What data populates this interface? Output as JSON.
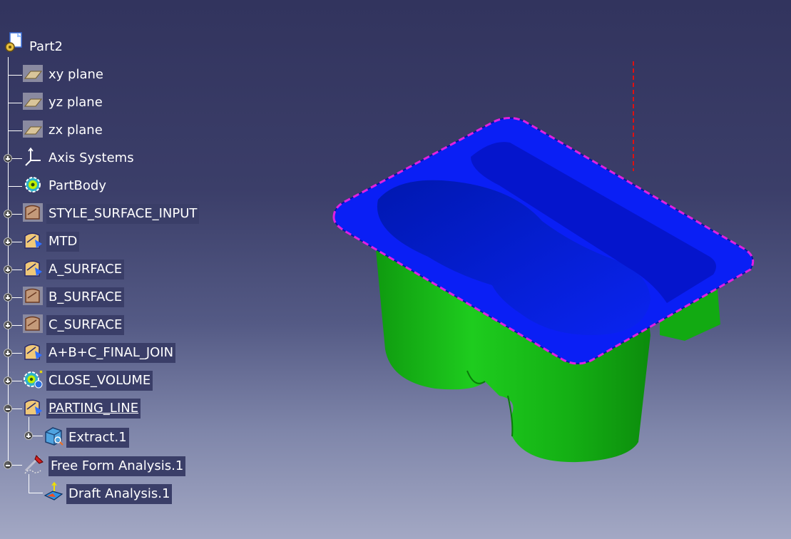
{
  "tree": {
    "root": {
      "label": "Part2",
      "icon": "part-icon"
    },
    "nodes": [
      {
        "label": "xy plane",
        "icon": "plane-icon"
      },
      {
        "label": "yz plane",
        "icon": "plane-icon"
      },
      {
        "label": "zx plane",
        "icon": "plane-icon"
      },
      {
        "label": "Axis Systems",
        "icon": "axis-system-icon"
      },
      {
        "label": "PartBody",
        "icon": "partbody-gear-icon"
      },
      {
        "label": "STYLE_SURFACE_INPUT",
        "icon": "geometrical-set-hidden-icon"
      },
      {
        "label": "MTD",
        "icon": "geometrical-set-icon"
      },
      {
        "label": "A_SURFACE",
        "icon": "geometrical-set-icon"
      },
      {
        "label": "B_SURFACE",
        "icon": "geometrical-set-hidden-icon"
      },
      {
        "label": "C_SURFACE",
        "icon": "geometrical-set-hidden-icon"
      },
      {
        "label": "A+B+C_FINAL_JOIN",
        "icon": "geometrical-set-icon"
      },
      {
        "label": "CLOSE_VOLUME",
        "icon": "body-gear-icon"
      },
      {
        "label": "PARTING_LINE",
        "icon": "geometrical-set-icon"
      },
      {
        "label": "Extract.1",
        "icon": "extract-icon"
      },
      {
        "label": "Free Form Analysis.1",
        "icon": "free-form-analysis-icon"
      },
      {
        "label": "Draft Analysis.1",
        "icon": "draft-analysis-icon"
      }
    ]
  },
  "colors": {
    "background_top": "#32345e",
    "background_bottom": "#a3a8c4",
    "flange_surface": "#0a1ff5",
    "body_surface": "#17c217",
    "parting_line": "#e020e0",
    "axis_line": "#e01010"
  }
}
